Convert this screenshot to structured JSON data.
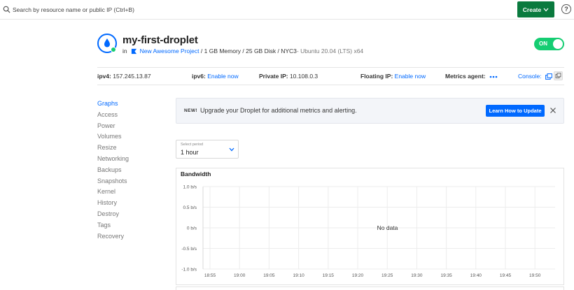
{
  "topbar": {
    "search_placeholder": "Search by resource name or public IP (Ctrl+B)",
    "create_label": "Create",
    "help_label": "?"
  },
  "droplet": {
    "name": "my-first-droplet",
    "in_label": "in",
    "project": "New Awesome Project",
    "specs": "/ 1 GB Memory / 25 GB Disk / NYC3",
    "os": " - Ubuntu 20.04 (LTS) x64",
    "power_label": "ON"
  },
  "info": {
    "ipv4_label": "ipv4:",
    "ipv4_value": "157.245.13.87",
    "ipv6_label": "ipv6:",
    "ipv6_link": "Enable now",
    "private_label": "Private IP:",
    "private_value": "10.108.0.3",
    "floating_label": "Floating IP:",
    "floating_link": "Enable now",
    "metrics_label": "Metrics agent:",
    "console_label": "Console:"
  },
  "nav": [
    "Graphs",
    "Access",
    "Power",
    "Volumes",
    "Resize",
    "Networking",
    "Backups",
    "Snapshots",
    "Kernel",
    "History",
    "Destroy",
    "Tags",
    "Recovery"
  ],
  "banner": {
    "tag": "NEW!",
    "message": "Upgrade your Droplet for additional metrics and alerting.",
    "button": "Learn How to Update"
  },
  "period": {
    "label": "Select period",
    "value": "1 hour"
  },
  "chart_data": {
    "type": "line",
    "title": "Bandwidth",
    "x": [
      "18:55",
      "19:00",
      "19:05",
      "19:10",
      "19:15",
      "19:20",
      "19:25",
      "19:30",
      "19:35",
      "19:40",
      "19:45",
      "19:50"
    ],
    "yticks": [
      "1.0 b/s",
      "0.5 b/s",
      "0 b/s",
      "-0.5 b/s",
      "-1.0 b/s"
    ],
    "ylim": [
      -1.0,
      1.0
    ],
    "series": [],
    "grid": true,
    "empty_message": "No data"
  },
  "colors": {
    "accent": "#0069ff",
    "create_green": "#0a7a3e",
    "status_green": "#15cd72"
  }
}
